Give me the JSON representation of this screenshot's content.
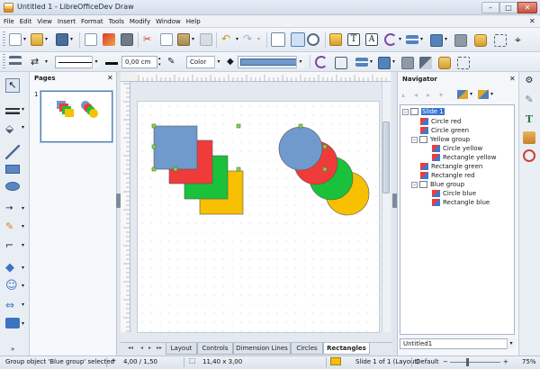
{
  "window": {
    "title": "Untitled 1 - LibreOfficeDev Draw",
    "minimize": "–",
    "maximize": "□",
    "close": "✕"
  },
  "menu": {
    "items": [
      "File",
      "Edit",
      "View",
      "Insert",
      "Format",
      "Tools",
      "Modify",
      "Window",
      "Help"
    ],
    "close_glyph": "✕"
  },
  "toolbar2": {
    "line_width": "0,00 cm",
    "area_style": "Color"
  },
  "pages_pane": {
    "title": "Pages",
    "close_glyph": "✕",
    "slide_number": "1"
  },
  "tabs": [
    {
      "label": "Layout",
      "active": false
    },
    {
      "label": "Controls",
      "active": false
    },
    {
      "label": "Dimension Lines",
      "active": false
    },
    {
      "label": "Circles",
      "active": false
    },
    {
      "label": "Rectangles",
      "active": true
    }
  ],
  "navigator": {
    "title": "Navigator",
    "close_glyph": "✕",
    "document": "Untitled1",
    "tree": [
      {
        "label": "Slide 1",
        "level": 0,
        "kind": "slide",
        "expanded": true,
        "selected": true
      },
      {
        "label": "Circle red",
        "level": 1,
        "kind": "shape"
      },
      {
        "label": "Circle green",
        "level": 1,
        "kind": "shape"
      },
      {
        "label": "Yellow group",
        "level": 1,
        "kind": "group",
        "expanded": true
      },
      {
        "label": "Circle yellow",
        "level": 2,
        "kind": "shape"
      },
      {
        "label": "Rectangle yellow",
        "level": 2,
        "kind": "shape"
      },
      {
        "label": "Rectangle green",
        "level": 1,
        "kind": "shape"
      },
      {
        "label": "Rectangle red",
        "level": 1,
        "kind": "shape"
      },
      {
        "label": "Blue group",
        "level": 1,
        "kind": "group",
        "expanded": true
      },
      {
        "label": "Circle blue",
        "level": 2,
        "kind": "shape"
      },
      {
        "label": "Rectangle blue",
        "level": 2,
        "kind": "shape"
      }
    ]
  },
  "status": {
    "message": "Group object 'Blue group' selected",
    "position": "4,00 / 1,50",
    "size": "11,40 x 3,00",
    "slide": "Slide 1 of 1 (Layout)",
    "style": "Default",
    "zoom": "75%"
  },
  "colors": {
    "blue": "#7099cc",
    "red": "#f03b3b",
    "green": "#19c23a",
    "yellow": "#f7c000",
    "selection": "#8bd15a"
  }
}
